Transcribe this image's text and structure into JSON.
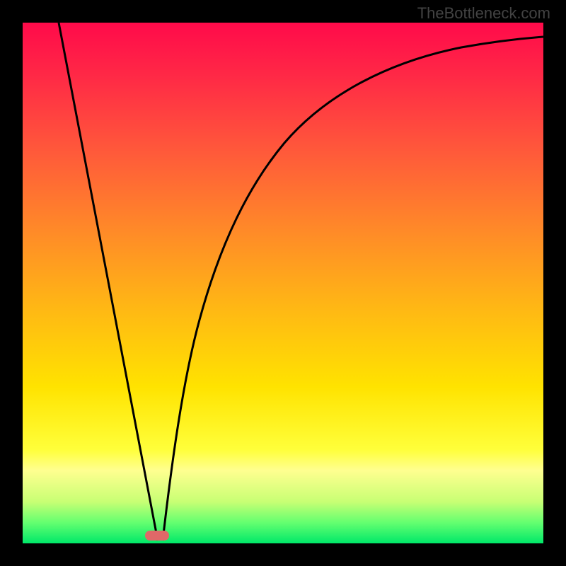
{
  "watermark": "TheBottleneck.com",
  "chart_data": {
    "type": "line",
    "title": "",
    "xlabel": "",
    "ylabel": "",
    "xlim": [
      0,
      100
    ],
    "ylim": [
      0,
      100
    ],
    "grid": false,
    "axes_visible": false,
    "background": "red-to-green vertical gradient",
    "series": [
      {
        "name": "left-branch",
        "x": [
          7,
          26
        ],
        "y": [
          100,
          0
        ]
      },
      {
        "name": "right-branch",
        "x": [
          27,
          30,
          34,
          38,
          44,
          50,
          58,
          66,
          74,
          82,
          90,
          100
        ],
        "y": [
          0,
          20,
          38,
          50,
          62,
          70,
          78,
          83,
          86,
          88,
          90,
          91
        ]
      }
    ],
    "marker": {
      "x": 26,
      "y": 0,
      "label": ""
    }
  }
}
